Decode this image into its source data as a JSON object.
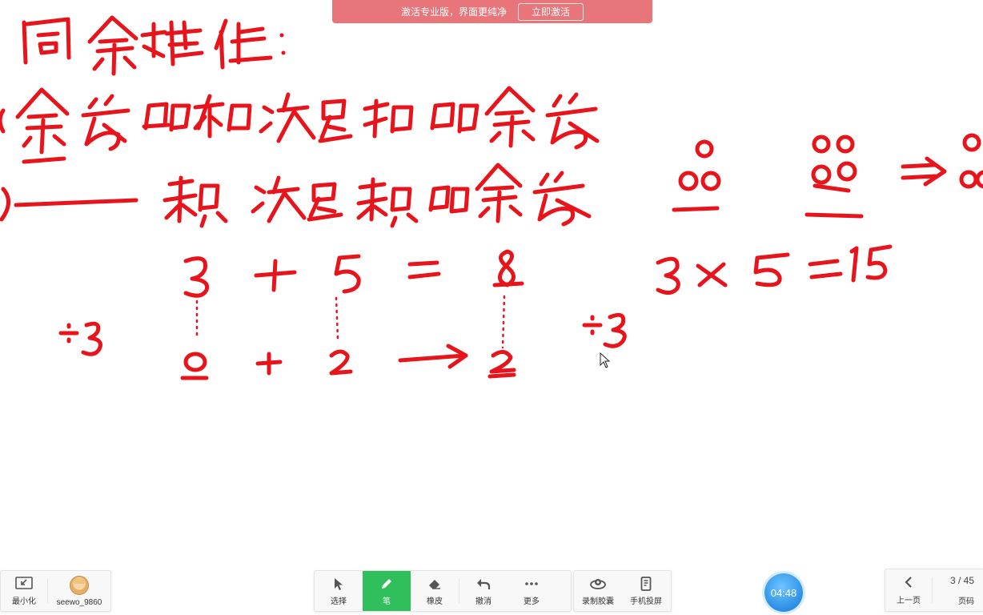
{
  "banner": {
    "message": "激活专业版，界面更纯净",
    "button_label": "立即激活"
  },
  "board": {
    "ink_color": "#e8141b",
    "lines": {
      "title": "同余特性:",
      "rule1": "余数的和决定和的余数",
      "rule2": "——积决定积的余数",
      "eq_add": [
        "3",
        "+",
        "5",
        "=",
        "8"
      ],
      "mod_label_left": "÷3",
      "rem_add": [
        "0",
        "+",
        "2",
        "→",
        "2"
      ],
      "mod_label_right": "÷3",
      "eq_mul": "3×5=15"
    }
  },
  "toolbar_left": {
    "minimize_label": "最小化",
    "username": "seewo_9860"
  },
  "toolbar_main": {
    "active_color": "#2fbf5b",
    "tools": [
      {
        "label": "选择",
        "icon": "cursor-icon"
      },
      {
        "label": "笔",
        "icon": "pen-icon"
      },
      {
        "label": "橡皮",
        "icon": "eraser-icon"
      },
      {
        "label": "撤消",
        "icon": "undo-icon"
      },
      {
        "label": "更多",
        "icon": "more-icon"
      }
    ],
    "extra": [
      {
        "label": "录制胶囊",
        "icon": "record-capsule-icon"
      },
      {
        "label": "手机投屏",
        "icon": "phone-cast-icon"
      }
    ]
  },
  "timer": {
    "time": "04:48"
  },
  "pager": {
    "prev_label": "上一页",
    "page_indicator": "3 / 45",
    "page_label": "页码"
  }
}
